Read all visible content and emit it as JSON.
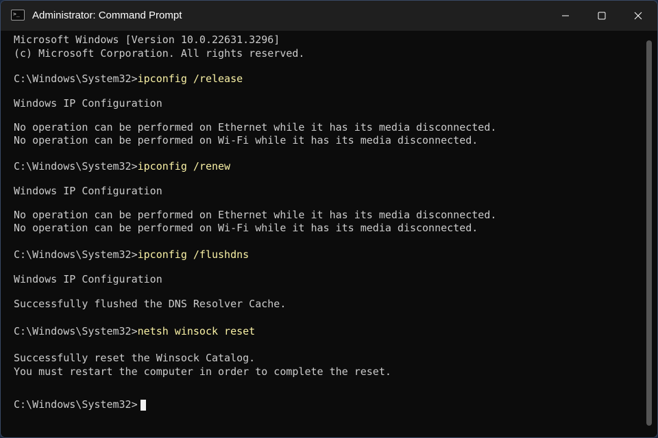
{
  "window": {
    "title": "Administrator: Command Prompt",
    "icon": "command-prompt-icon",
    "icon_text": ">_",
    "controls": [
      "minimize-icon",
      "maximize-icon",
      "close-icon"
    ]
  },
  "colors": {
    "background": "#0c0c0c",
    "text": "#cccccc",
    "command": "#f9f1a5",
    "titlebar": "#1f1f1f"
  },
  "terminal": {
    "banner": [
      "Microsoft Windows [Version 10.0.22631.3296]",
      "(c) Microsoft Corporation. All rights reserved."
    ],
    "blocks": [
      {
        "prompt": "C:\\Windows\\System32>",
        "command": "ipconfig /release",
        "output": [
          "Windows IP Configuration",
          "No operation can be performed on Ethernet while it has its media disconnected.",
          "No operation can be performed on Wi-Fi while it has its media disconnected."
        ]
      },
      {
        "prompt": "C:\\Windows\\System32>",
        "command": "ipconfig /renew",
        "output": [
          "Windows IP Configuration",
          "No operation can be performed on Ethernet while it has its media disconnected.",
          "No operation can be performed on Wi-Fi while it has its media disconnected."
        ]
      },
      {
        "prompt": "C:\\Windows\\System32>",
        "command": "ipconfig /flushdns",
        "output": [
          "Windows IP Configuration",
          "Successfully flushed the DNS Resolver Cache."
        ]
      },
      {
        "prompt": "C:\\Windows\\System32>",
        "command": "netsh winsock reset",
        "output": [
          "Successfully reset the Winsock Catalog.",
          "You must restart the computer in order to complete the reset."
        ]
      }
    ],
    "current_prompt": "C:\\Windows\\System32>"
  }
}
